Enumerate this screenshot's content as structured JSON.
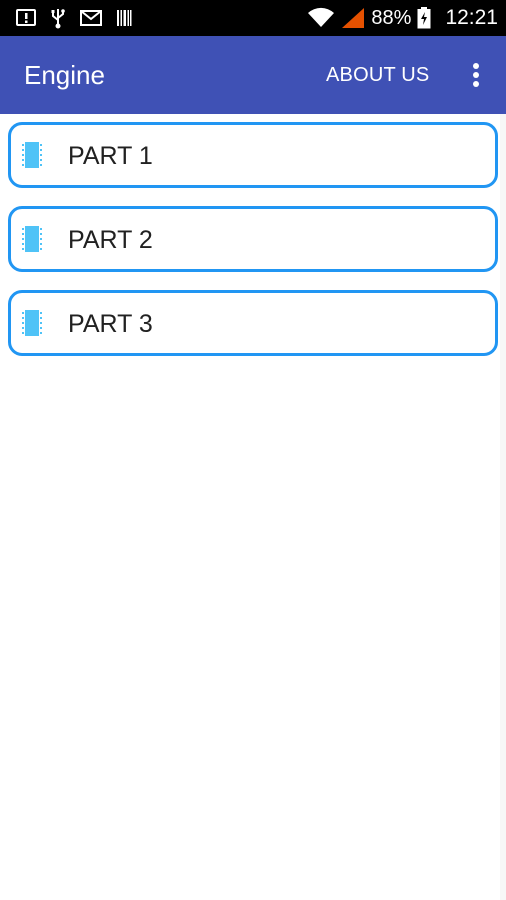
{
  "status_bar": {
    "battery": "88%",
    "time": "12:21",
    "left_icons": [
      "alert-icon",
      "usb-icon",
      "mail-icon",
      "barcode-icon"
    ],
    "right_icons": [
      "wifi-icon",
      "signal-icon",
      "battery-icon"
    ],
    "colors": {
      "signal": "#E65100"
    }
  },
  "app_bar": {
    "title": "Engine",
    "about_label": "ABOUT US",
    "overflow_icon": "more-vert-icon",
    "color": "#3F51B5"
  },
  "parts": [
    {
      "label": "PART 1",
      "icon": "chip-icon"
    },
    {
      "label": "PART 2",
      "icon": "chip-icon"
    },
    {
      "label": "PART 3",
      "icon": "chip-icon"
    }
  ],
  "colors": {
    "accent": "#2196F3",
    "chip": "#4FC3F7"
  }
}
